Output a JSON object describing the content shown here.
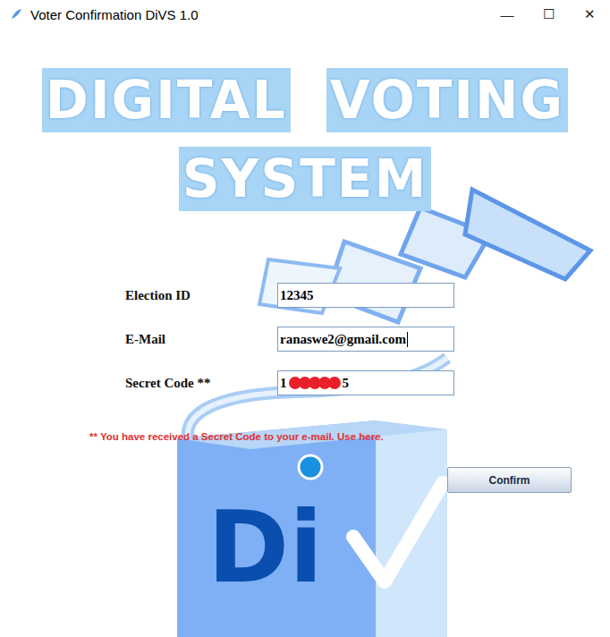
{
  "window": {
    "title": "Voter Confirmation DiVS 1.0",
    "controls": [
      "—",
      "☐",
      "✕"
    ]
  },
  "banner": {
    "lines": [
      [
        "DIGITAL",
        "VOTING"
      ],
      [
        "SYSTEM"
      ]
    ]
  },
  "form": {
    "fields": [
      {
        "kind": "text",
        "label": "Election ID",
        "value": "12345",
        "focused": false
      },
      {
        "kind": "text",
        "label": "E-Mail",
        "value": "ranaswe2@gmail.com",
        "focused": true
      },
      {
        "kind": "secret",
        "label": "Secret Code **",
        "value_start": "1",
        "value_end": "5",
        "redacted": true,
        "focused": false
      }
    ]
  },
  "note": "** You have received a Secret Code to your e-mail. Use here.",
  "logo": {
    "text": "Di"
  },
  "buttons": [
    "Confirm"
  ]
}
